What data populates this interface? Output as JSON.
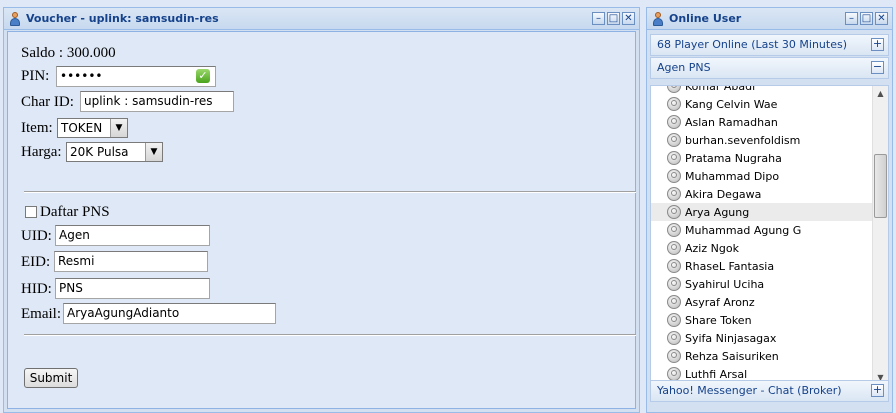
{
  "voucher_window": {
    "title": "Voucher - uplink: samsudin-res",
    "saldo": "Saldo : 300.000",
    "pin_label": "PIN:",
    "pin_value": "••••••",
    "char_id_label": "Char ID:",
    "char_id_value": "uplink : samsudin-res",
    "item_label": "Item:",
    "item_value": "TOKEN",
    "harga_label": "Harga:",
    "harga_value": "20K Pulsa",
    "daftar_label": "Daftar PNS",
    "uid_label": "UID:",
    "uid_value": "Agen",
    "eid_label": "EID:",
    "eid_value": "Resmi",
    "hid_label": "HID:",
    "hid_value": "PNS",
    "email_label": "Email:",
    "email_value": "AryaAgungAdianto",
    "submit_label": "Submit"
  },
  "online_window": {
    "title": "Online User",
    "section_online": "68 Player Online (Last 30 Minutes)",
    "section_agen": "Agen PNS",
    "section_chat": "Yahoo! Messenger - Chat (Broker)",
    "users": [
      {
        "name": "Komar Abadi"
      },
      {
        "name": "Kang Celvin Wae"
      },
      {
        "name": "Aslan Ramadhan"
      },
      {
        "name": "burhan.sevenfoldism"
      },
      {
        "name": "Pratama Nugraha"
      },
      {
        "name": "Muhammad Dipo"
      },
      {
        "name": "Akira Degawa"
      },
      {
        "name": "Arya Agung"
      },
      {
        "name": "Muhammad Agung G"
      },
      {
        "name": "Aziz Ngok"
      },
      {
        "name": "RhaseL Fantasia"
      },
      {
        "name": "Syahirul Uciha"
      },
      {
        "name": "Asyraf Aronz"
      },
      {
        "name": "Share Token"
      },
      {
        "name": "Syifa Ninjasagax"
      },
      {
        "name": "Rehza Saisuriken"
      },
      {
        "name": "Luthfi Arsal"
      }
    ],
    "selected_user": "Arya Agung"
  },
  "icons": {
    "window_icon": "user-icon",
    "minimize": "minimize-icon",
    "maximize": "maximize-icon",
    "close": "close-icon",
    "valid": "checkmark-icon",
    "expand": "plus-icon",
    "collapse": "minus-icon",
    "user_status": "user-status-icon"
  },
  "colors": {
    "title_text": "#15428b",
    "panel_border": "#99bbe8",
    "body_bg": "#dfe8f6"
  }
}
